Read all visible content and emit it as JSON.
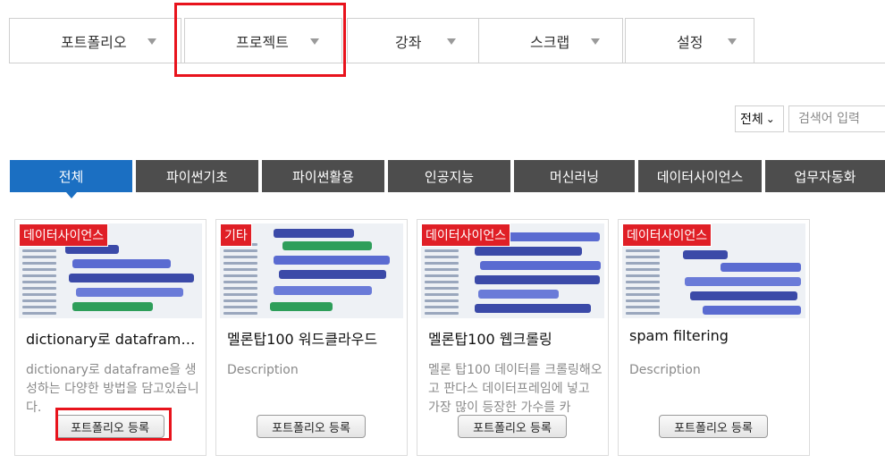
{
  "nav": {
    "tabs": [
      {
        "label": "포트폴리오"
      },
      {
        "label": "프로젝트"
      },
      {
        "label": "강좌"
      },
      {
        "label": "스크랩"
      },
      {
        "label": "설정"
      }
    ]
  },
  "search": {
    "scope_selected": "전체",
    "placeholder": "검색어 입력"
  },
  "categories": [
    {
      "label": "전체"
    },
    {
      "label": "파이썬기초"
    },
    {
      "label": "파이썬활용"
    },
    {
      "label": "인공지능"
    },
    {
      "label": "머신러닝"
    },
    {
      "label": "데이터사이언스"
    },
    {
      "label": "업무자동화"
    }
  ],
  "cards": [
    {
      "badge": "데이터사이언스",
      "title": "dictionary로 dataframe…",
      "description": "dictionary로 dataframe을 생성하는 다양한 방법을 담고있습니다.",
      "button": "포트폴리오 등록"
    },
    {
      "badge": "기타",
      "title": "멜론탑100 워드클라우드",
      "description": "Description",
      "button": "포트폴리오 등록"
    },
    {
      "badge": "데이터사이언스",
      "title": "멜론탑100 웹크롤링",
      "description": "멜론 탑100 데이터를 크롤링해오고 판다스 데이터프레임에 넣고 가장 많이 등장한 가수를 카",
      "button": "포트폴리오 등록"
    },
    {
      "badge": "데이터사이언스",
      "title": "spam filtering",
      "description": "Description",
      "button": "포트폴리오 등록"
    }
  ],
  "colors": {
    "active_blue": "#1b6fc2",
    "category_dark": "#4d4d4d",
    "badge_red": "#e01f26",
    "highlight_red": "#e8131c"
  }
}
